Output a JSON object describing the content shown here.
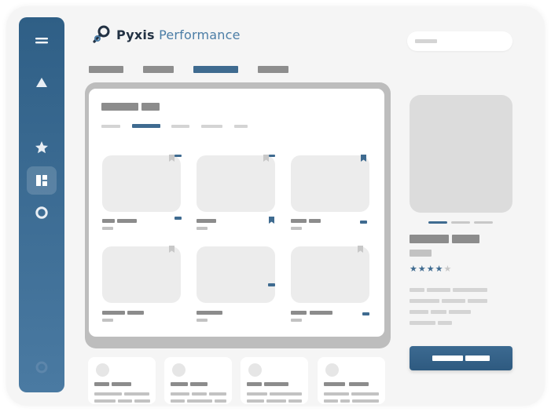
{
  "app": {
    "brand_primary": "Pyxis",
    "brand_secondary": "Performance",
    "brand_color": "#233244",
    "accent": "#3f6b90"
  },
  "sidebar": {
    "items": [
      {
        "icon": "menu-icon",
        "active": false
      },
      {
        "icon": "triangle-icon",
        "active": false
      },
      {
        "icon": "star-icon",
        "active": false
      },
      {
        "icon": "dashboard-icon",
        "active": true
      },
      {
        "icon": "circle-icon",
        "active": false
      },
      {
        "icon": "settings-icon",
        "active": false
      }
    ]
  },
  "search": {
    "placeholder": "",
    "value": ""
  },
  "nav": {
    "tab_count": 4,
    "active_tab_index": 2
  },
  "product_grid": {
    "card_count": 6,
    "bookmarked_cards": [
      2,
      3
    ]
  },
  "detail": {
    "rating": {
      "value": 4,
      "max": 5
    },
    "carousel": {
      "slides": 3,
      "active_index": 0
    }
  },
  "related_cards": {
    "count": 4
  }
}
